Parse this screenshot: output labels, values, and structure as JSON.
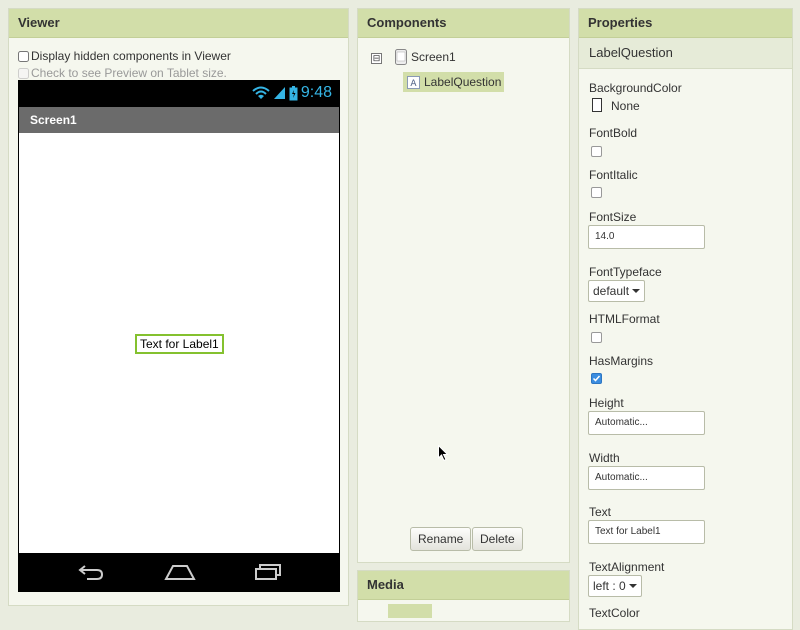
{
  "viewer": {
    "title": "Viewer",
    "hidden_components_label": "Display hidden components in Viewer",
    "tablet_preview_label": "Check to see Preview on Tablet size.",
    "phone": {
      "time": "9:48",
      "screen_title": "Screen1",
      "label_text": "Text for Label1"
    }
  },
  "components": {
    "title": "Components",
    "tree": {
      "toggle": "⊟",
      "root": "Screen1",
      "child": "LabelQuestion"
    },
    "rename_label": "Rename",
    "delete_label": "Delete"
  },
  "media": {
    "title": "Media"
  },
  "properties": {
    "title": "Properties",
    "selected_component": "LabelQuestion",
    "background_color": {
      "label": "BackgroundColor",
      "value": "None"
    },
    "font_bold": {
      "label": "FontBold",
      "checked": false
    },
    "font_italic": {
      "label": "FontItalic",
      "checked": false
    },
    "font_size": {
      "label": "FontSize",
      "value": "14.0"
    },
    "font_typeface": {
      "label": "FontTypeface",
      "value": "default"
    },
    "html_format": {
      "label": "HTMLFormat",
      "checked": false
    },
    "has_margins": {
      "label": "HasMargins",
      "checked": true
    },
    "height": {
      "label": "Height",
      "value": "Automatic..."
    },
    "width": {
      "label": "Width",
      "value": "Automatic..."
    },
    "text": {
      "label": "Text",
      "value": "Text for Label1"
    },
    "text_alignment": {
      "label": "TextAlignment",
      "value": "left : 0"
    },
    "text_color": {
      "label": "TextColor"
    }
  },
  "colors": {
    "header_bg": "#d2dea9",
    "panel_bg": "#f5f7ee",
    "selection_border": "#84c12f",
    "status_blue": "#35b5e5",
    "checkbox_checked": "#3b8de0"
  },
  "icons": {
    "wifi": "wifi-icon",
    "signal": "signal-icon",
    "battery": "battery-icon",
    "back": "back-icon",
    "home": "home-icon",
    "recent": "recent-apps-icon",
    "screen": "screen-icon",
    "label": "label-icon",
    "cursor": "mouse-cursor-icon"
  }
}
